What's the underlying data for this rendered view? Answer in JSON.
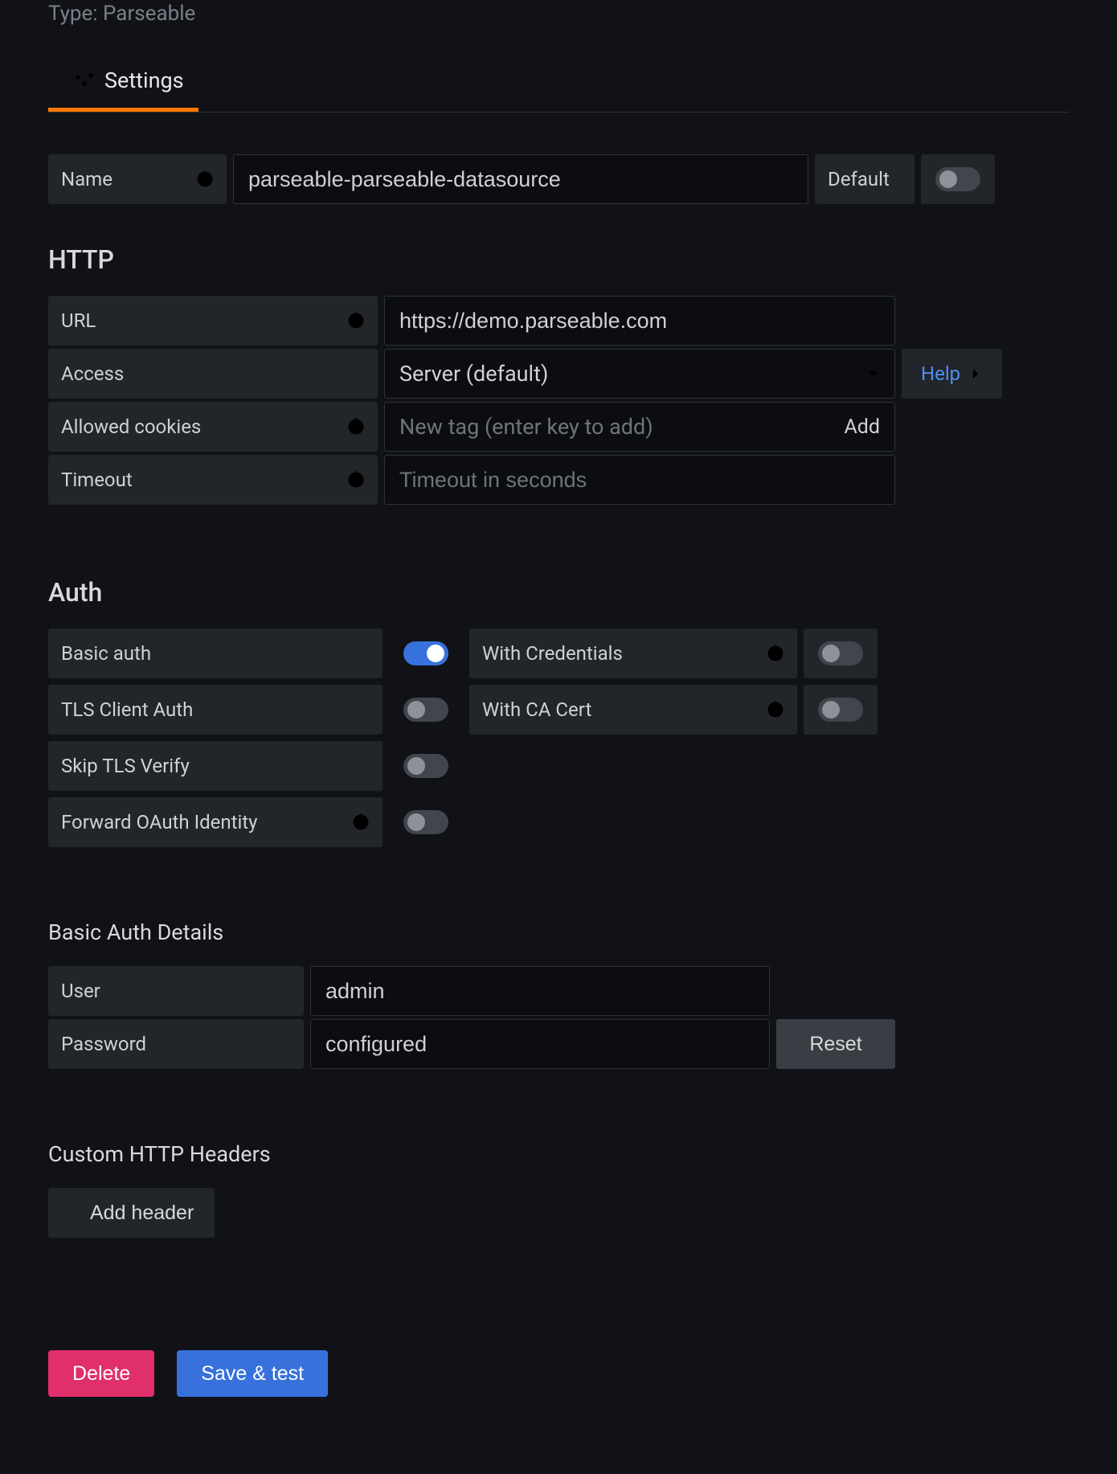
{
  "type_line": "Type: Parseable",
  "tab": {
    "label": "Settings"
  },
  "name": {
    "label": "Name",
    "value": "parseable-parseable-datasource",
    "default_label": "Default",
    "default_on": false
  },
  "http": {
    "section_title": "HTTP",
    "url": {
      "label": "URL",
      "value": "https://demo.parseable.com"
    },
    "access": {
      "label": "Access",
      "value": "Server (default)",
      "help_label": "Help"
    },
    "allowed_cookies": {
      "label": "Allowed cookies",
      "placeholder": "New tag (enter key to add)",
      "add_label": "Add"
    },
    "timeout": {
      "label": "Timeout",
      "placeholder": "Timeout in seconds"
    }
  },
  "auth": {
    "section_title": "Auth",
    "basic_auth": {
      "label": "Basic auth",
      "on": true
    },
    "with_credentials": {
      "label": "With Credentials",
      "on": false
    },
    "tls_client_auth": {
      "label": "TLS Client Auth",
      "on": false
    },
    "with_ca_cert": {
      "label": "With CA Cert",
      "on": false
    },
    "skip_tls_verify": {
      "label": "Skip TLS Verify",
      "on": false
    },
    "forward_oauth": {
      "label": "Forward OAuth Identity",
      "on": false
    }
  },
  "basic_auth_details": {
    "section_title": "Basic Auth Details",
    "user": {
      "label": "User",
      "value": "admin"
    },
    "password": {
      "label": "Password",
      "value": "configured",
      "reset_label": "Reset"
    }
  },
  "custom_headers": {
    "section_title": "Custom HTTP Headers",
    "add_label": "Add header"
  },
  "footer": {
    "delete_label": "Delete",
    "save_label": "Save & test"
  }
}
